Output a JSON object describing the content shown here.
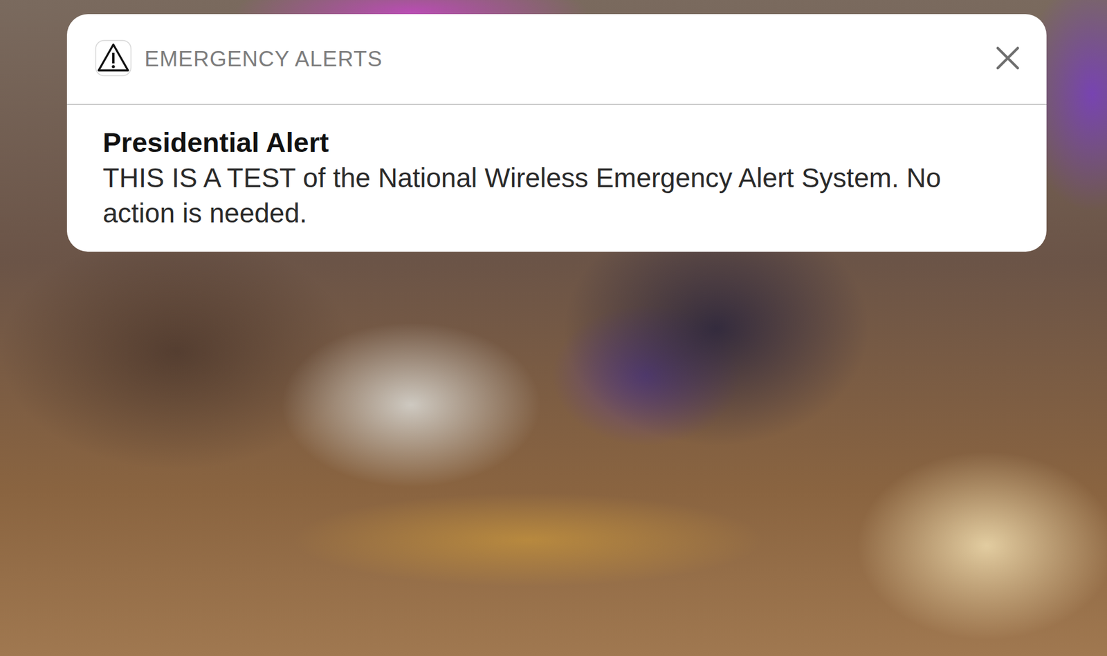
{
  "notification": {
    "app": "EMERGENCY ALERTS",
    "title": "Presidential Alert",
    "body": "THIS IS A TEST of the National Wireless Emergency Alert System. No action is needed."
  }
}
